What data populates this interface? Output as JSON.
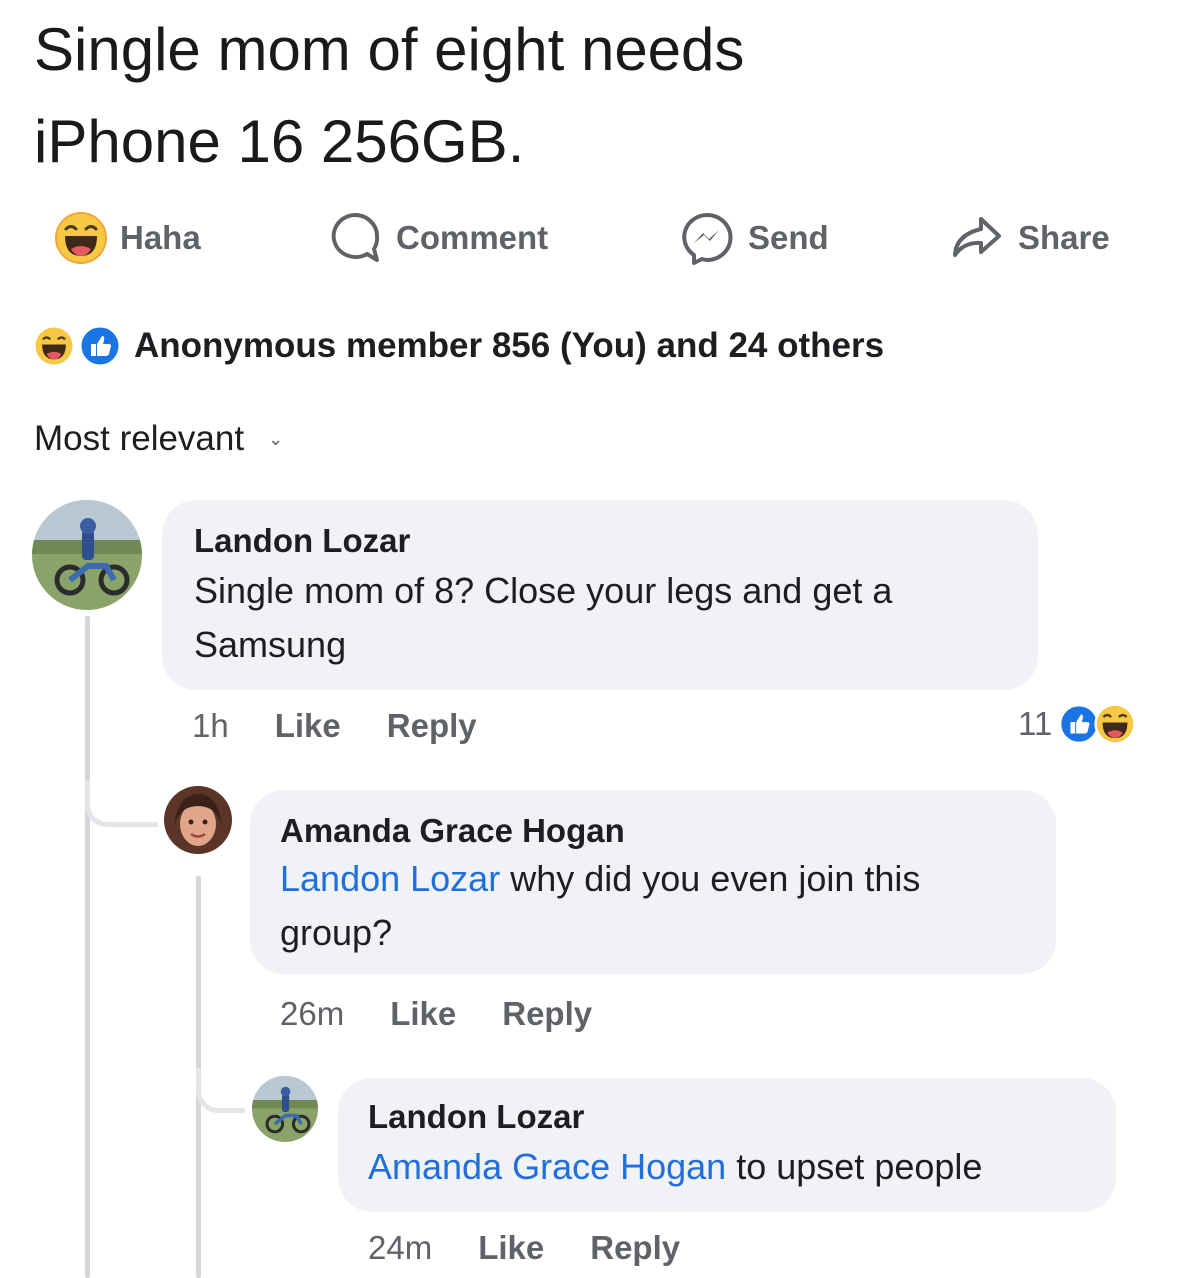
{
  "post": {
    "title_line1": "Single mom of eight needs",
    "title_line2": "iPhone 16 256GB."
  },
  "actions": {
    "haha": "Haha",
    "comment": "Comment",
    "send": "Send",
    "share": "Share"
  },
  "reactions_summary": "Anonymous member 856 (You) and 24 others",
  "sort_label": "Most relevant",
  "comments": [
    {
      "author": "Landon Lozar",
      "text_line1": "Single mom of 8? Close your legs and get a",
      "text_line2": "Samsung",
      "time": "1h",
      "like": "Like",
      "reply": "Reply",
      "reaction_count": "11"
    },
    {
      "author": "Amanda Grace Hogan",
      "mention": "Landon Lozar",
      "text_line1": " why did you even join this",
      "text_line2": "group?",
      "time": "26m",
      "like": "Like",
      "reply": "Reply"
    },
    {
      "author": "Landon Lozar",
      "mention": "Amanda Grace Hogan",
      "text": " to upset people",
      "time": "24m",
      "like": "Like",
      "reply": "Reply"
    }
  ],
  "colors": {
    "accent_blue": "#216fdb",
    "bubble": "#f0f2f5",
    "haha_yellow": "#f7c844"
  }
}
